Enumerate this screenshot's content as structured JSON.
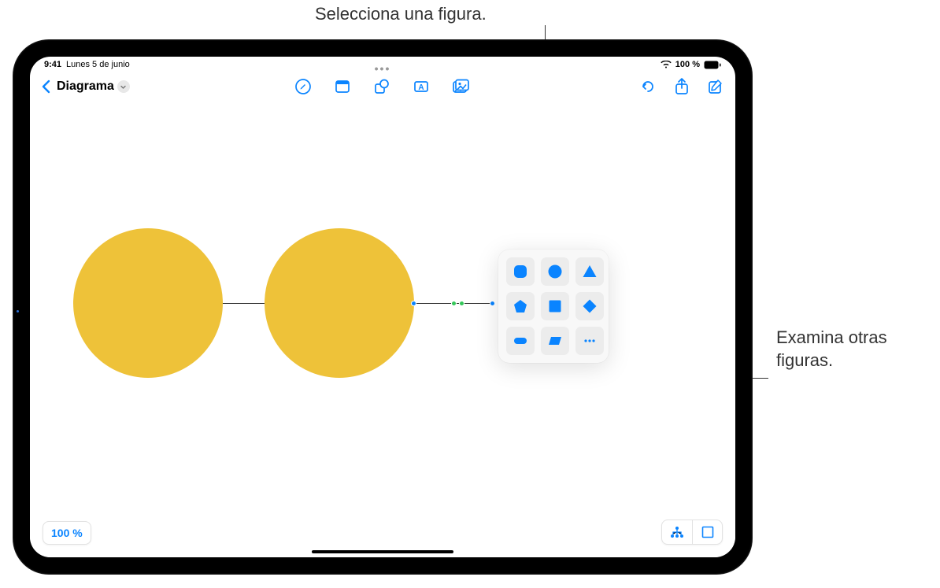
{
  "callouts": {
    "top": "Selecciona una figura.",
    "right_line1": "Examina otras",
    "right_line2": "figuras."
  },
  "status": {
    "time": "9:41",
    "date": "Lunes 5 de junio",
    "battery": "100 %"
  },
  "toolbar": {
    "doc_title": "Diagrama",
    "icons": {
      "back": "chevron-left",
      "draw": "draw-pen",
      "sticky": "sticky-note",
      "shapes": "shapes",
      "text": "text-box",
      "media": "media",
      "undo": "undo",
      "share": "share",
      "compose": "compose"
    }
  },
  "shape_popup": {
    "shapes": [
      "rounded-square",
      "circle",
      "triangle",
      "pentagon",
      "square",
      "diamond",
      "pill",
      "parallelogram",
      "more"
    ]
  },
  "canvas": {
    "objects": [
      "circle",
      "circle",
      "connector"
    ],
    "shape_color": "#eec239"
  },
  "zoom": {
    "level": "100 %"
  },
  "bottom_controls": {
    "diagram_mode": "diagram-icon",
    "select_mode": "select-icon"
  }
}
